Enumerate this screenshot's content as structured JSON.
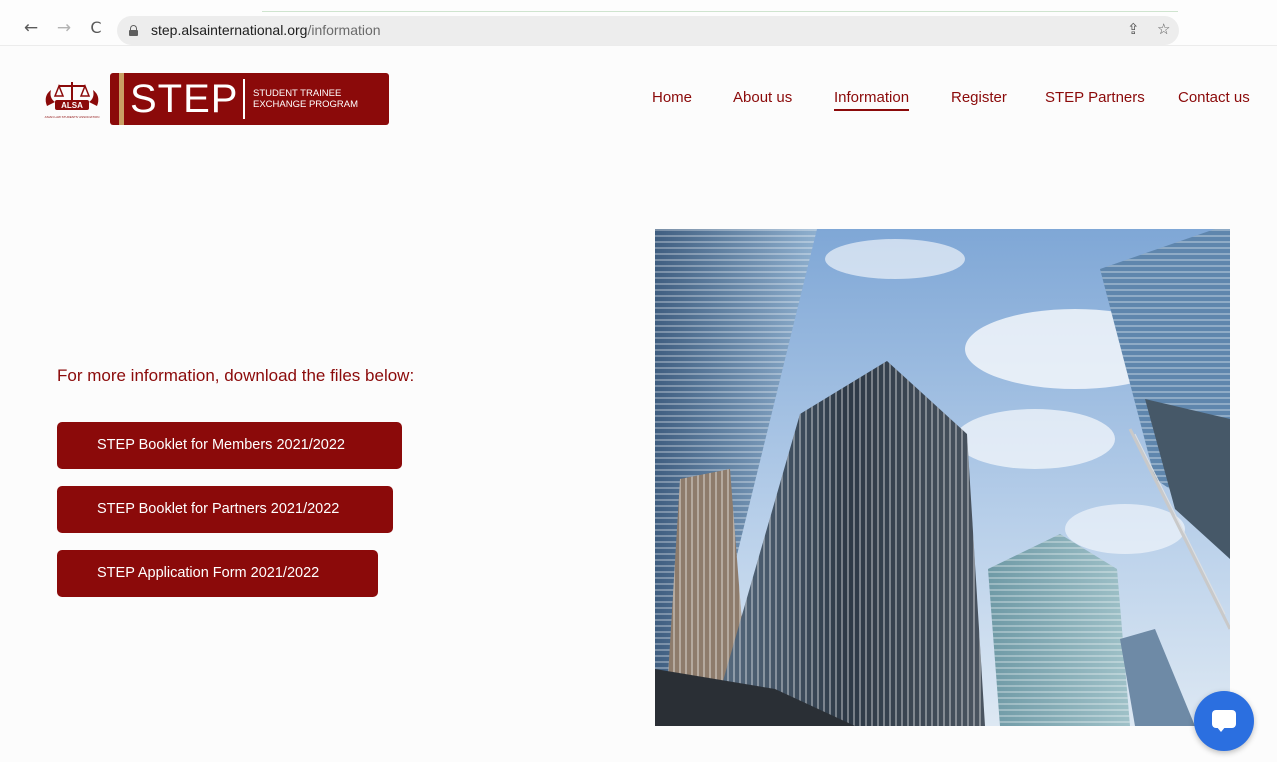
{
  "browser": {
    "url_host": "step.alsainternational.org",
    "url_path": "/information",
    "back_icon": "←",
    "forward_icon": "→",
    "reload_icon": "C",
    "share_icon": "⇪",
    "star_icon": "☆"
  },
  "header": {
    "logo_word": "STEP",
    "logo_sub_line1": "STUDENT TRAINEE",
    "logo_sub_line2": "EXCHANGE PROGRAM",
    "emblem_text": "ALSA",
    "emblem_caption": "ASIAN LAW STUDENTS' ASSOCIATION",
    "nav": [
      {
        "label": "Home"
      },
      {
        "label": "About us"
      },
      {
        "label": "Information"
      },
      {
        "label": "Register"
      },
      {
        "label": "STEP Partners"
      },
      {
        "label": "Contact us"
      }
    ],
    "active_nav": "Information"
  },
  "main": {
    "intro": "For more information, download the files below:",
    "buttons": [
      {
        "label": "STEP Booklet for Members 2021/2022"
      },
      {
        "label": "STEP Booklet for Partners 2021/2022"
      },
      {
        "label": "STEP Application Form 2021/2022"
      }
    ]
  },
  "colors": {
    "brand": "#8b0a0a",
    "accent_gold": "#c9a064",
    "chat": "#2b6fe0"
  }
}
